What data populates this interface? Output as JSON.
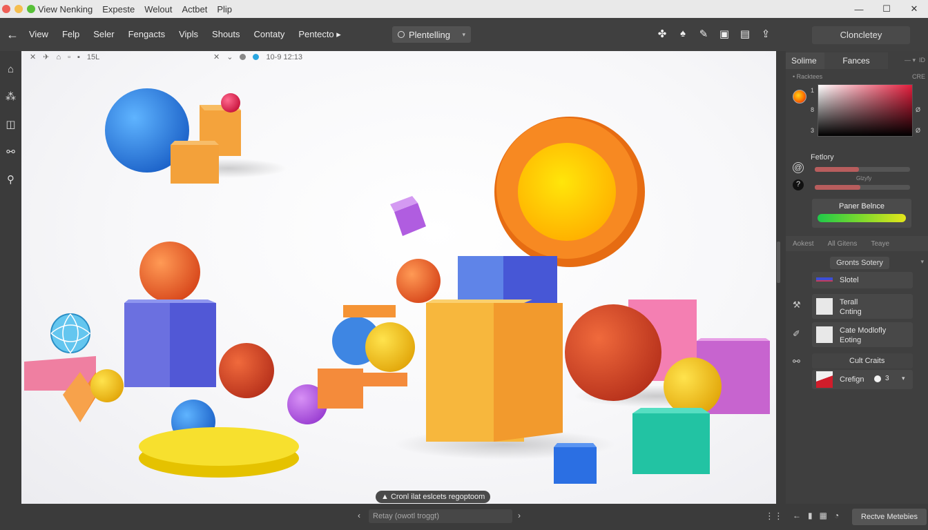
{
  "titlebar": {
    "menu": [
      "View Nenking",
      "Expeste",
      "Welout",
      "Actbet",
      "Plip"
    ],
    "controls": [
      "—",
      "☐",
      "✕"
    ]
  },
  "menubar": {
    "items": [
      "View",
      "Felp",
      "Seler",
      "Fengacts",
      "Vipls",
      "Shouts",
      "Contaty",
      "Pentecto ▸"
    ],
    "mode_label": "Plentelling",
    "complete_label": "Cloncletey"
  },
  "canvas": {
    "info_count": "15L",
    "info_time": "10-9 12:13",
    "toast": "Cronl ilat eslcets regoptoom"
  },
  "bottombar": {
    "nav_field": "Retay (owotl troggt)",
    "active_materials": "Rectve Metebies"
  },
  "panel": {
    "tabs": [
      "Solime",
      "Fances"
    ],
    "small_label": "• Racktees",
    "small_label_r": "CRE",
    "color_nums": [
      "1",
      "8",
      "3"
    ],
    "color_nums_r": [
      "Ø",
      "Ø"
    ],
    "section1": "Fetlory",
    "slider_label": "Glzyfy",
    "gradient_label": "Paner Belnce",
    "subtabs": [
      "Aokest",
      "All Gitens",
      "Teaye"
    ],
    "group_button": "Gronts Sotery",
    "materials": [
      {
        "l1": "Slotel",
        "l2": ""
      },
      {
        "l1": "Terall",
        "l2": "Cnting"
      },
      {
        "l1": "Cate Modlofly",
        "l2": "Eoting"
      },
      {
        "l1": "Cult Craits",
        "l2": ""
      },
      {
        "l1": "Crefign",
        "l2": "3"
      }
    ]
  },
  "colors": {
    "bg": "#3b3b3b",
    "canvas": "#f6f6f8",
    "accent_green": "#1fc94a"
  }
}
